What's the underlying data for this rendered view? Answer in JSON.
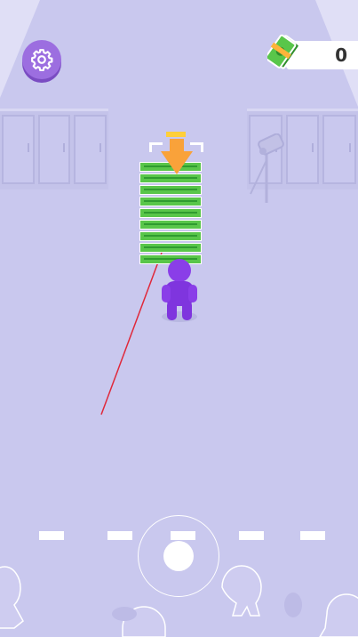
{
  "hud": {
    "settings_icon": "gear-icon",
    "cash_icon": "cash-stack-icon",
    "cash_count": "0"
  },
  "scene": {
    "floor_color": "#c9c8ee",
    "accent_purple": "#9c6ee0",
    "cash_green": "#59c64a",
    "arrow_orange": "#f9a23a",
    "laser_red": "#e0283a"
  },
  "money_stack": {
    "bill_count": 9
  },
  "controls": {
    "joystick": "virtual-joystick"
  }
}
